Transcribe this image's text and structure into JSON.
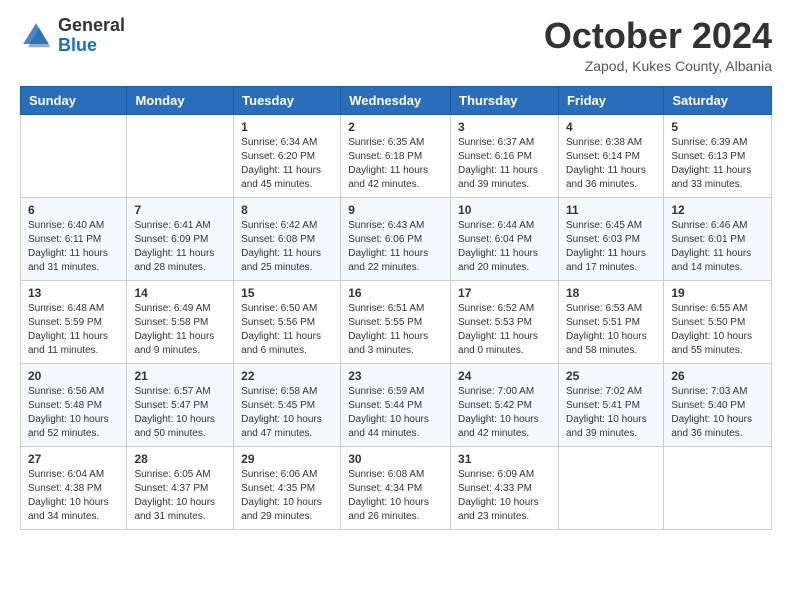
{
  "header": {
    "logo_line1": "General",
    "logo_line2": "Blue",
    "month": "October 2024",
    "location": "Zapod, Kukes County, Albania"
  },
  "days_of_week": [
    "Sunday",
    "Monday",
    "Tuesday",
    "Wednesday",
    "Thursday",
    "Friday",
    "Saturday"
  ],
  "weeks": [
    [
      {
        "day": "",
        "info": ""
      },
      {
        "day": "",
        "info": ""
      },
      {
        "day": "1",
        "info": "Sunrise: 6:34 AM\nSunset: 6:20 PM\nDaylight: 11 hours and 45 minutes."
      },
      {
        "day": "2",
        "info": "Sunrise: 6:35 AM\nSunset: 6:18 PM\nDaylight: 11 hours and 42 minutes."
      },
      {
        "day": "3",
        "info": "Sunrise: 6:37 AM\nSunset: 6:16 PM\nDaylight: 11 hours and 39 minutes."
      },
      {
        "day": "4",
        "info": "Sunrise: 6:38 AM\nSunset: 6:14 PM\nDaylight: 11 hours and 36 minutes."
      },
      {
        "day": "5",
        "info": "Sunrise: 6:39 AM\nSunset: 6:13 PM\nDaylight: 11 hours and 33 minutes."
      }
    ],
    [
      {
        "day": "6",
        "info": "Sunrise: 6:40 AM\nSunset: 6:11 PM\nDaylight: 11 hours and 31 minutes."
      },
      {
        "day": "7",
        "info": "Sunrise: 6:41 AM\nSunset: 6:09 PM\nDaylight: 11 hours and 28 minutes."
      },
      {
        "day": "8",
        "info": "Sunrise: 6:42 AM\nSunset: 6:08 PM\nDaylight: 11 hours and 25 minutes."
      },
      {
        "day": "9",
        "info": "Sunrise: 6:43 AM\nSunset: 6:06 PM\nDaylight: 11 hours and 22 minutes."
      },
      {
        "day": "10",
        "info": "Sunrise: 6:44 AM\nSunset: 6:04 PM\nDaylight: 11 hours and 20 minutes."
      },
      {
        "day": "11",
        "info": "Sunrise: 6:45 AM\nSunset: 6:03 PM\nDaylight: 11 hours and 17 minutes."
      },
      {
        "day": "12",
        "info": "Sunrise: 6:46 AM\nSunset: 6:01 PM\nDaylight: 11 hours and 14 minutes."
      }
    ],
    [
      {
        "day": "13",
        "info": "Sunrise: 6:48 AM\nSunset: 5:59 PM\nDaylight: 11 hours and 11 minutes."
      },
      {
        "day": "14",
        "info": "Sunrise: 6:49 AM\nSunset: 5:58 PM\nDaylight: 11 hours and 9 minutes."
      },
      {
        "day": "15",
        "info": "Sunrise: 6:50 AM\nSunset: 5:56 PM\nDaylight: 11 hours and 6 minutes."
      },
      {
        "day": "16",
        "info": "Sunrise: 6:51 AM\nSunset: 5:55 PM\nDaylight: 11 hours and 3 minutes."
      },
      {
        "day": "17",
        "info": "Sunrise: 6:52 AM\nSunset: 5:53 PM\nDaylight: 11 hours and 0 minutes."
      },
      {
        "day": "18",
        "info": "Sunrise: 6:53 AM\nSunset: 5:51 PM\nDaylight: 10 hours and 58 minutes."
      },
      {
        "day": "19",
        "info": "Sunrise: 6:55 AM\nSunset: 5:50 PM\nDaylight: 10 hours and 55 minutes."
      }
    ],
    [
      {
        "day": "20",
        "info": "Sunrise: 6:56 AM\nSunset: 5:48 PM\nDaylight: 10 hours and 52 minutes."
      },
      {
        "day": "21",
        "info": "Sunrise: 6:57 AM\nSunset: 5:47 PM\nDaylight: 10 hours and 50 minutes."
      },
      {
        "day": "22",
        "info": "Sunrise: 6:58 AM\nSunset: 5:45 PM\nDaylight: 10 hours and 47 minutes."
      },
      {
        "day": "23",
        "info": "Sunrise: 6:59 AM\nSunset: 5:44 PM\nDaylight: 10 hours and 44 minutes."
      },
      {
        "day": "24",
        "info": "Sunrise: 7:00 AM\nSunset: 5:42 PM\nDaylight: 10 hours and 42 minutes."
      },
      {
        "day": "25",
        "info": "Sunrise: 7:02 AM\nSunset: 5:41 PM\nDaylight: 10 hours and 39 minutes."
      },
      {
        "day": "26",
        "info": "Sunrise: 7:03 AM\nSunset: 5:40 PM\nDaylight: 10 hours and 36 minutes."
      }
    ],
    [
      {
        "day": "27",
        "info": "Sunrise: 6:04 AM\nSunset: 4:38 PM\nDaylight: 10 hours and 34 minutes."
      },
      {
        "day": "28",
        "info": "Sunrise: 6:05 AM\nSunset: 4:37 PM\nDaylight: 10 hours and 31 minutes."
      },
      {
        "day": "29",
        "info": "Sunrise: 6:06 AM\nSunset: 4:35 PM\nDaylight: 10 hours and 29 minutes."
      },
      {
        "day": "30",
        "info": "Sunrise: 6:08 AM\nSunset: 4:34 PM\nDaylight: 10 hours and 26 minutes."
      },
      {
        "day": "31",
        "info": "Sunrise: 6:09 AM\nSunset: 4:33 PM\nDaylight: 10 hours and 23 minutes."
      },
      {
        "day": "",
        "info": ""
      },
      {
        "day": "",
        "info": ""
      }
    ]
  ]
}
